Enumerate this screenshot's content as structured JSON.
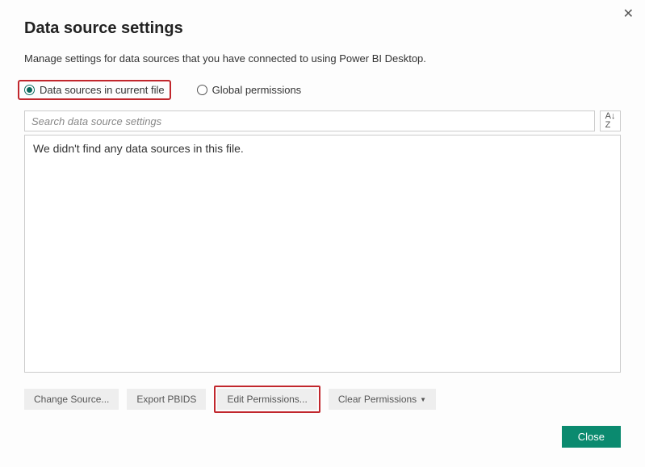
{
  "dialog": {
    "title": "Data source settings",
    "subtitle": "Manage settings for data sources that you have connected to using Power BI Desktop."
  },
  "scope": {
    "current_file_label": "Data sources in current file",
    "global_label": "Global permissions",
    "selected": "current_file"
  },
  "search": {
    "placeholder": "Search data source settings"
  },
  "list": {
    "empty_message": "We didn't find any data sources in this file."
  },
  "buttons": {
    "change_source": "Change Source...",
    "export_pbids": "Export PBIDS",
    "edit_permissions": "Edit Permissions...",
    "clear_permissions": "Clear Permissions",
    "close": "Close"
  }
}
